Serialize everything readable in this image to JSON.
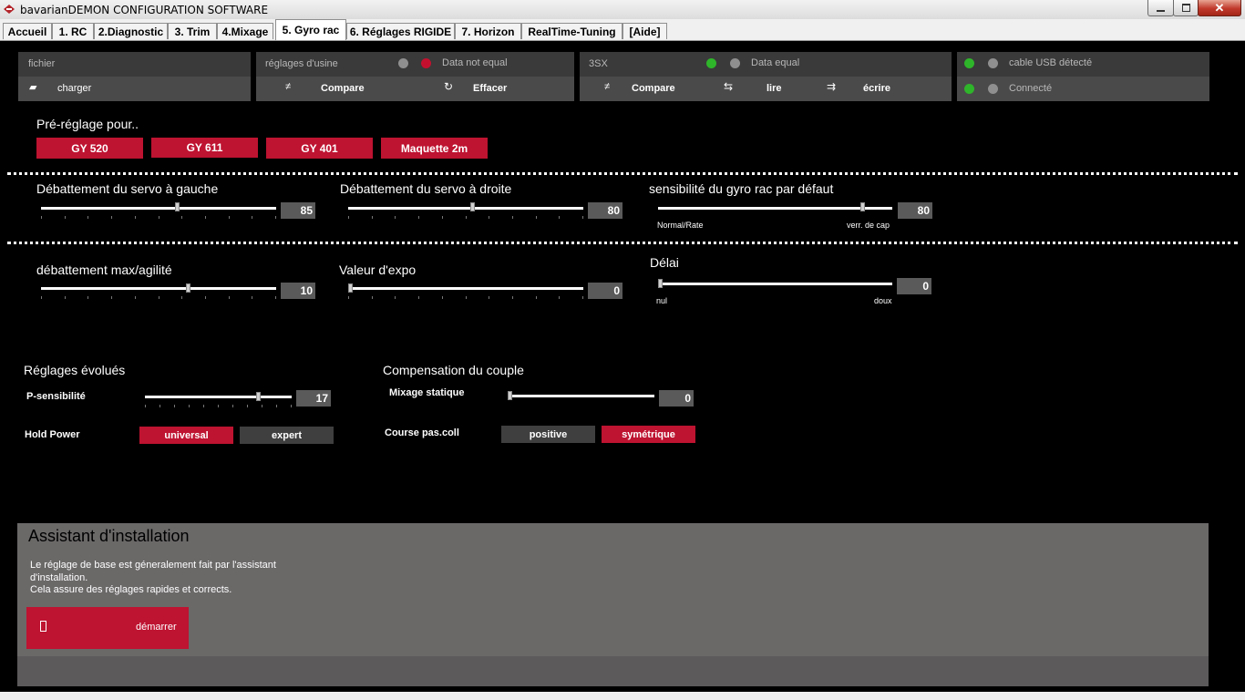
{
  "window": {
    "title": "bavarianDEMON CONFIGURATION SOFTWARE"
  },
  "tabs": [
    "Accueil",
    "1. RC",
    "2.Diagnostic",
    "3. Trim",
    "4.Mixage",
    "5. Gyro rac",
    "6. Réglages RIGIDE",
    "7. Horizon",
    "RealTime-Tuning",
    "[Aide]"
  ],
  "active_tab": "5. Gyro rac",
  "panels": {
    "file": {
      "header": "fichier",
      "load": "charger"
    },
    "factory": {
      "header": "réglages d'usine",
      "status": "Data not equal",
      "compare": "Compare",
      "clear": "Effacer"
    },
    "device": {
      "header": "3SX",
      "status": "Data equal",
      "compare": "Compare",
      "read": "lire",
      "write": "écrire"
    },
    "connection": {
      "usb": "cable USB détecté",
      "connected": "Connecté"
    }
  },
  "preset": {
    "title": "Pré-réglage pour..",
    "buttons": [
      "GY 520",
      "GY 611",
      "GY 401",
      "Maquette 2m"
    ]
  },
  "sliders": {
    "servo_left": {
      "label": "Débattement du servo à gauche",
      "value": "85",
      "level": 0.58
    },
    "servo_right": {
      "label": "Débattement du servo à droite",
      "value": "80",
      "level": 0.53
    },
    "gyro_sens": {
      "label": "sensibilité du gyro rac par défaut",
      "value": "80",
      "level": 0.88,
      "min_label": "Normal/Rate",
      "max_label": "verr. de cap"
    },
    "max_agility": {
      "label": "débattement max/agilité",
      "value": "10",
      "level": 0.63
    },
    "expo": {
      "label": "Valeur d'expo",
      "value": "0",
      "level": 0.0
    },
    "delay": {
      "label": "Délai",
      "value": "0",
      "level": 0.0,
      "min_label": "nul",
      "max_label": "doux"
    }
  },
  "advanced": {
    "title": "Réglages évolués",
    "p_sens": {
      "label": "P-sensibilité",
      "value": "17",
      "level": 0.78
    },
    "hold_power": {
      "label": "Hold Power",
      "options": [
        "universal",
        "expert"
      ],
      "selected": "universal"
    }
  },
  "torque": {
    "title": "Compensation du couple",
    "static_mix": {
      "label": "Mixage statique",
      "value": "0",
      "level": 0.0
    },
    "collective": {
      "label": "Course pas.coll",
      "options": [
        "positive",
        "symétrique"
      ],
      "selected": "symétrique"
    }
  },
  "assistant": {
    "title": "Assistant d'installation",
    "desc": [
      "Le réglage de base est géneralement fait par l'assistant",
      "d'installation.",
      "Cela assure des réglages rapides et corrects."
    ],
    "start": "démarrer"
  },
  "colors": {
    "accent_red": "#be1331",
    "panel": "#3b3b3b",
    "green": "#2fb52a",
    "assistant_bg": "#6b6868"
  }
}
